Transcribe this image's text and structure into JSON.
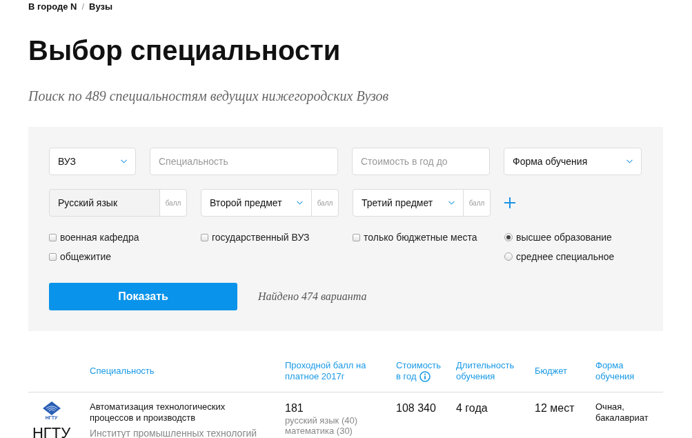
{
  "breadcrumbs": [
    {
      "label": "В городе N"
    },
    {
      "label": "Вузы"
    }
  ],
  "breadcrumb_separator": "/",
  "title": "Выбор специальности",
  "subtitle": "Поиск по 489 специальностям ведущих нижегородских Вузов",
  "filters": [
    {
      "kind": "select",
      "value": "ВУЗ"
    },
    {
      "kind": "input",
      "placeholder": "Специальность"
    },
    {
      "kind": "input",
      "placeholder": "Стоимость в год до"
    },
    {
      "kind": "select",
      "value": "Форма обучения"
    }
  ],
  "subjects": [
    {
      "kind": "fixed",
      "value": "Русский язык",
      "score": {
        "placeholder": "балл"
      }
    },
    {
      "kind": "select",
      "value": "Второй предмет",
      "score": {
        "placeholder": "балл"
      }
    },
    {
      "kind": "select",
      "value": "Третий предмет",
      "score": {
        "placeholder": "балл"
      }
    }
  ],
  "option_columns": [
    {
      "items": [
        {
          "kind": "checkbox",
          "label": "военная кафедра",
          "checked": false
        },
        {
          "kind": "checkbox",
          "label": "общежитие",
          "checked": false
        }
      ]
    },
    {
      "items": [
        {
          "kind": "checkbox",
          "label": "государственный ВУЗ",
          "checked": false
        }
      ]
    },
    {
      "items": [
        {
          "kind": "checkbox",
          "label": "только бюджетные места",
          "checked": false
        }
      ]
    },
    {
      "items": [
        {
          "kind": "radio",
          "label": "высшее образование",
          "selected": true
        },
        {
          "kind": "radio",
          "label": "среднее специальное",
          "selected": false
        }
      ]
    }
  ],
  "search_button": "Показать",
  "results_count": "Найдено 474 варианта",
  "table": {
    "columns": [
      {
        "label": "Специальность",
        "info": false
      },
      {
        "label": "Проходной балл на платное 2017г",
        "info": false
      },
      {
        "label": "Стоимость в год",
        "info": true
      },
      {
        "label": "Длительность обучения",
        "info": false
      },
      {
        "label": "Бюджет",
        "info": false
      },
      {
        "label": "Форма обучения",
        "info": false
      }
    ],
    "rows": [
      {
        "logo_caption": "НГТУ",
        "university": "НГТУ",
        "specialty": "Автоматизация технологических процессов и производств",
        "institute": "Институт промышленных технологий",
        "score": "181",
        "exams": [
          "русский язык (40)",
          "математика (30)"
        ],
        "cost": "108 340",
        "duration": "4 года",
        "budget": "12 мест",
        "form": "Очная, бакалавриат"
      }
    ]
  }
}
